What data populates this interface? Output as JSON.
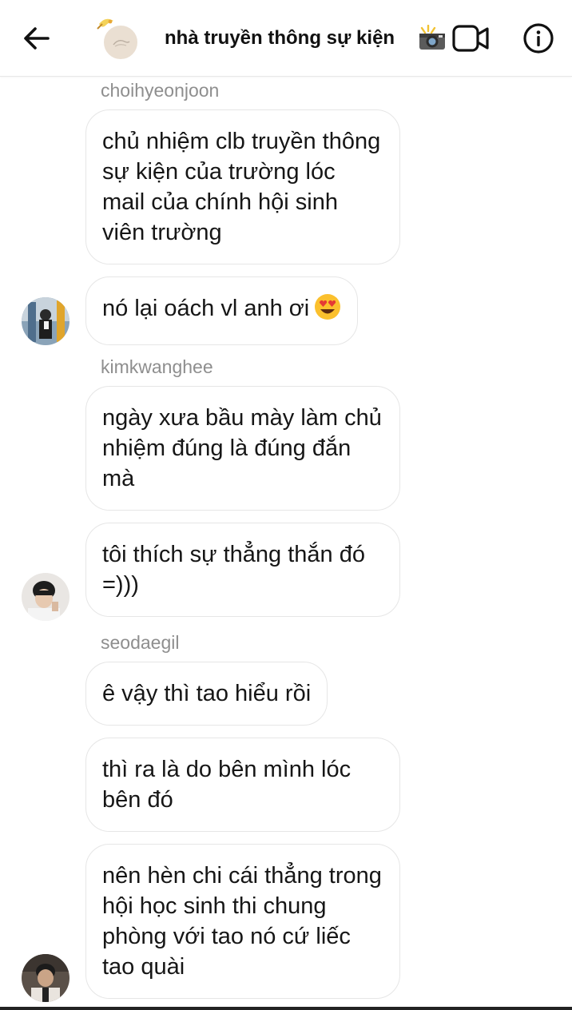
{
  "header": {
    "title": "nhà truyền thông sự kiện",
    "title_emoji": "camera-with-flash-icon"
  },
  "messages": [
    {
      "sender": "choihyeonjoon"
    },
    {
      "text": "chủ nhiệm clb truyền thông sự kiện của trường lóc mail của chính hội sinh viên trường"
    },
    {
      "text": "nó lại oách vl anh ơi",
      "emoji": "heart-eyes-emoji"
    },
    {
      "sender": "kimkwanghee"
    },
    {
      "text": "ngày xưa bầu mày làm chủ nhiệm đúng là đúng đắn mà"
    },
    {
      "text": "tôi thích sự thẳng thắn đó =)))"
    },
    {
      "sender": "seodaegil"
    },
    {
      "text": "ê vậy thì tao hiểu rồi"
    },
    {
      "text": "thì ra là do bên mình lóc bên đó"
    },
    {
      "text": "nên hèn chi cái thẳng trong hội học sinh thi chung phòng với tao nó cứ liếc tao quài"
    }
  ],
  "colors": {
    "sender_gray": "#8e8e8e",
    "bubble_border": "#e6e6e6",
    "text": "#161616"
  }
}
